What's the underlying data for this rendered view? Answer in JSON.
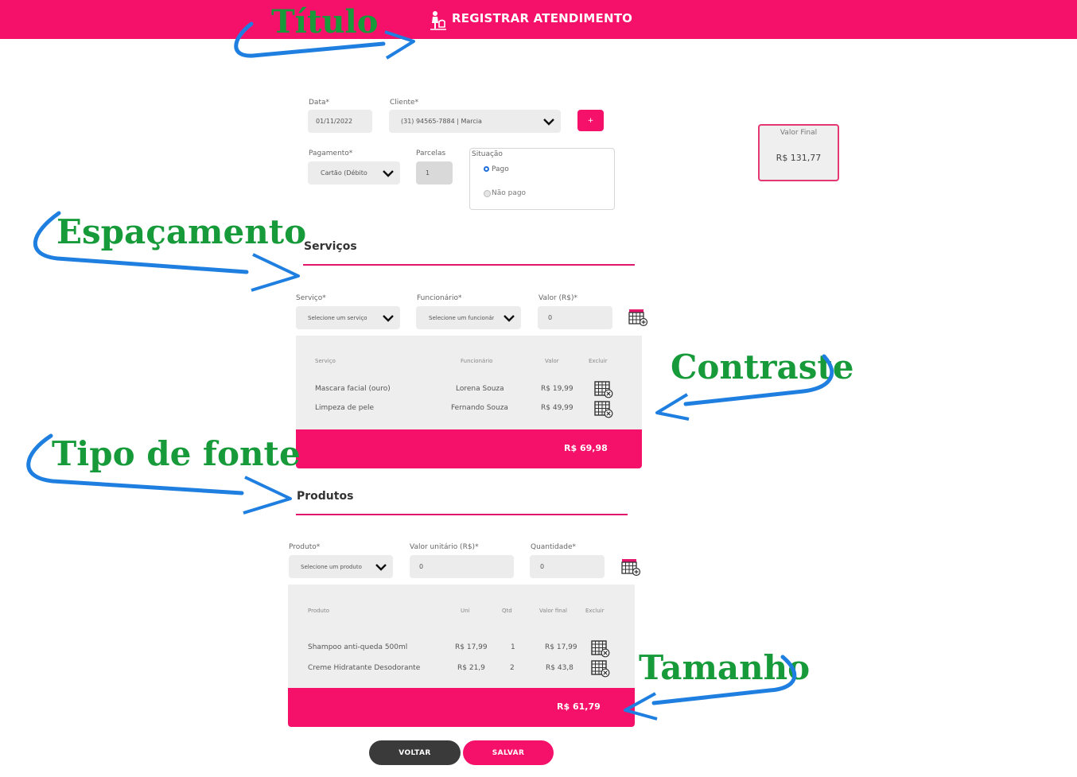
{
  "header": {
    "title": "REGISTRAR ATENDIMENTO",
    "icon": "pet-grooming-icon",
    "color": "#f5106a"
  },
  "form": {
    "data_label": "Data*",
    "data_value": "01/11/2022",
    "cliente_label": "Cliente*",
    "cliente_value": "(31) 94565-7884 | Marcia",
    "add_label": "+",
    "pagamento_label": "Pagamento*",
    "pagamento_value": "Cartão (Débito",
    "parcelas_label": "Parcelas",
    "parcelas_value": "1",
    "situacao_label": "Situação",
    "situacao_options": [
      "Pago",
      "Não pago"
    ],
    "situacao_selected": "Pago"
  },
  "valor_final": {
    "label": "Valor Final",
    "value": "R$ 131,77"
  },
  "servicos": {
    "title": "Serviços",
    "servico_label": "Serviço*",
    "servico_placeholder": "Selecione um serviço",
    "funcionario_label": "Funcionário*",
    "funcionario_placeholder": "Selecione um funcionário",
    "valor_label": "Valor (R$)*",
    "valor_value": "0",
    "table": {
      "headers": [
        "Serviço",
        "Funcionário",
        "Valor",
        "Excluir"
      ],
      "rows": [
        [
          "Mascara facial (ouro)",
          "Lorena Souza",
          "R$ 19,99"
        ],
        [
          "Limpeza de pele",
          "Fernando Souza",
          "R$ 49,99"
        ]
      ],
      "total": "R$ 69,98"
    }
  },
  "produtos": {
    "title": "Produtos",
    "produto_label": "Produto*",
    "produto_placeholder": "Selecione um produto",
    "valor_unitario_label": "Valor unitário (R$)*",
    "valor_unitario_value": "0",
    "quantidade_label": "Quantidade*",
    "quantidade_value": "0",
    "table": {
      "headers": [
        "Produto",
        "Uni",
        "Qtd",
        "Valor final",
        "Excluir"
      ],
      "rows": [
        [
          "Shampoo anti-queda 500ml",
          "R$ 17,99",
          "1",
          "R$ 17,99"
        ],
        [
          "Creme Hidratante Desodorante",
          "R$ 21,9",
          "2",
          "R$ 43,8"
        ]
      ],
      "total": "R$ 61,79"
    }
  },
  "buttons": {
    "voltar": "VOLTAR",
    "salvar": "SALVAR"
  },
  "annotations": {
    "titulo": "Título",
    "espacamento": "Espaçamento",
    "contraste": "Contraste",
    "tipo_fonte": "Tipo de fonte",
    "tamanho": "Tamanho"
  },
  "colors": {
    "accent": "#f5106a",
    "annotation_text": "#179b3a",
    "annotation_arrow": "#1f7fe0",
    "dark_button": "#3a3a3a"
  }
}
